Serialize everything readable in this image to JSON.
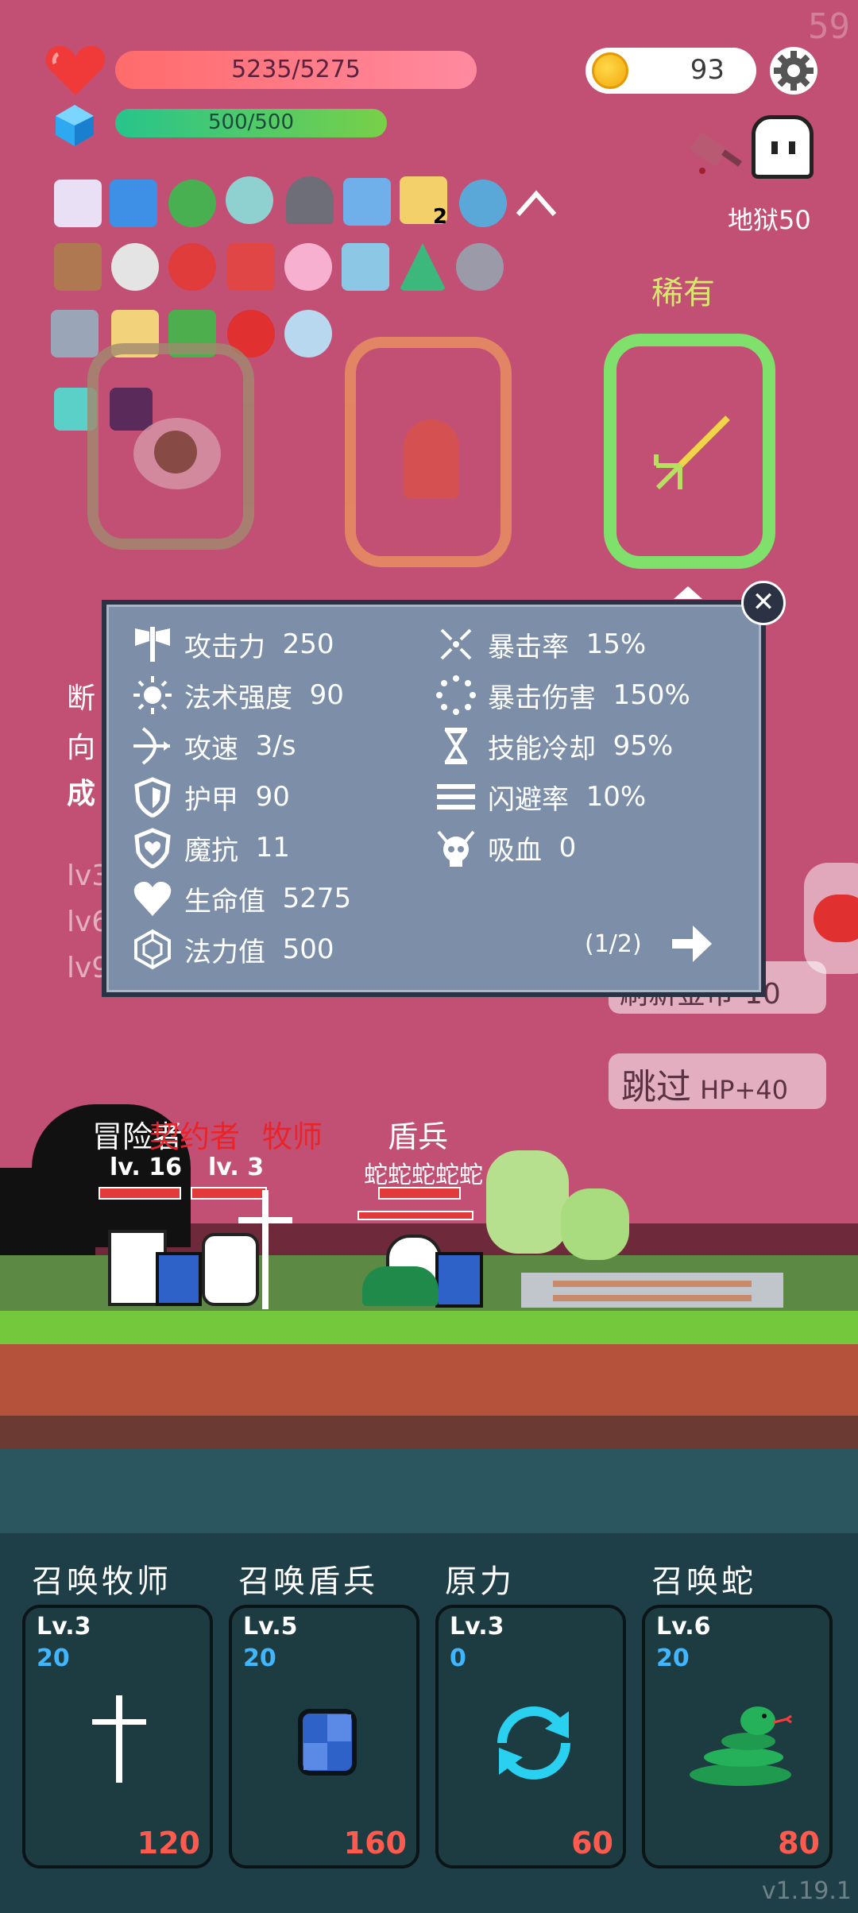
{
  "fps": "59",
  "player": {
    "hp_text": "5235/5275",
    "hp_fraction": 0.99,
    "mp_text": "500/500",
    "mp_fraction": 1.0
  },
  "coins": "93",
  "hell_label": "地狱50",
  "items_row_count_badge": "2",
  "cards": {
    "rarity_label": "稀有"
  },
  "stats_panel": {
    "left": [
      {
        "label": "攻击力",
        "value": "250",
        "icon": "axe-icon"
      },
      {
        "label": "法术强度",
        "value": "90",
        "icon": "sun-icon"
      },
      {
        "label": "攻速",
        "value": "3/s",
        "icon": "bow-icon"
      },
      {
        "label": "护甲",
        "value": "90",
        "icon": "shield-icon"
      },
      {
        "label": "魔抗",
        "value": "11",
        "icon": "heart-shield-icon"
      },
      {
        "label": "生命值",
        "value": "5275",
        "icon": "heart-icon"
      },
      {
        "label": "法力值",
        "value": "500",
        "icon": "hexagon-gem-icon"
      }
    ],
    "right": [
      {
        "label": "暴击率",
        "value": "15%",
        "icon": "crit-icon"
      },
      {
        "label": "暴击伤害",
        "value": "150%",
        "icon": "burst-icon"
      },
      {
        "label": "技能冷却",
        "value": "95%",
        "icon": "hourglass-icon"
      },
      {
        "label": "闪避率",
        "value": "10%",
        "icon": "lines-icon"
      },
      {
        "label": "吸血",
        "value": "0",
        "icon": "skull-icon"
      }
    ],
    "page": "(1/2)"
  },
  "background_text": {
    "line1": "断",
    "line2": "向",
    "line3": "成",
    "lv1": "lv3",
    "lv2": "lv6",
    "lv3": "lv9",
    "refresh_label": "刷新金币-10",
    "skip_label": "跳过",
    "skip_bonus": "HP+40"
  },
  "battle": {
    "allies": [
      {
        "name": "冒险者",
        "level": "lv. 16"
      },
      {
        "name": "契约者",
        "level": "lv. 3"
      },
      {
        "name": "牧师",
        "level": ""
      }
    ],
    "enemies": [
      {
        "name": "盾兵"
      },
      {
        "name": "蛇蛇蛇蛇蛇"
      }
    ]
  },
  "skills": [
    {
      "title": "召唤牧师",
      "level": "Lv.3",
      "num": "20",
      "cost": "120",
      "icon": "cross-icon"
    },
    {
      "title": "召唤盾兵",
      "level": "Lv.5",
      "num": "20",
      "cost": "160",
      "icon": "blue-shield-icon"
    },
    {
      "title": "原力",
      "level": "Lv.3",
      "num": "0",
      "cost": "60",
      "icon": "cycle-arrows-icon"
    },
    {
      "title": "召唤蛇",
      "level": "Lv.6",
      "num": "20",
      "cost": "80",
      "icon": "snake-icon"
    }
  ],
  "version": "v1.19.1",
  "colors": {
    "background": "#c24f74",
    "panel": "#7d8fa8",
    "hp_bar": "#ff6b6b",
    "mp_bar": "#27c48c",
    "rare_green": "#7fe06b",
    "cost_red": "#ff5a4e",
    "skill_num_blue": "#3fb6ff"
  }
}
